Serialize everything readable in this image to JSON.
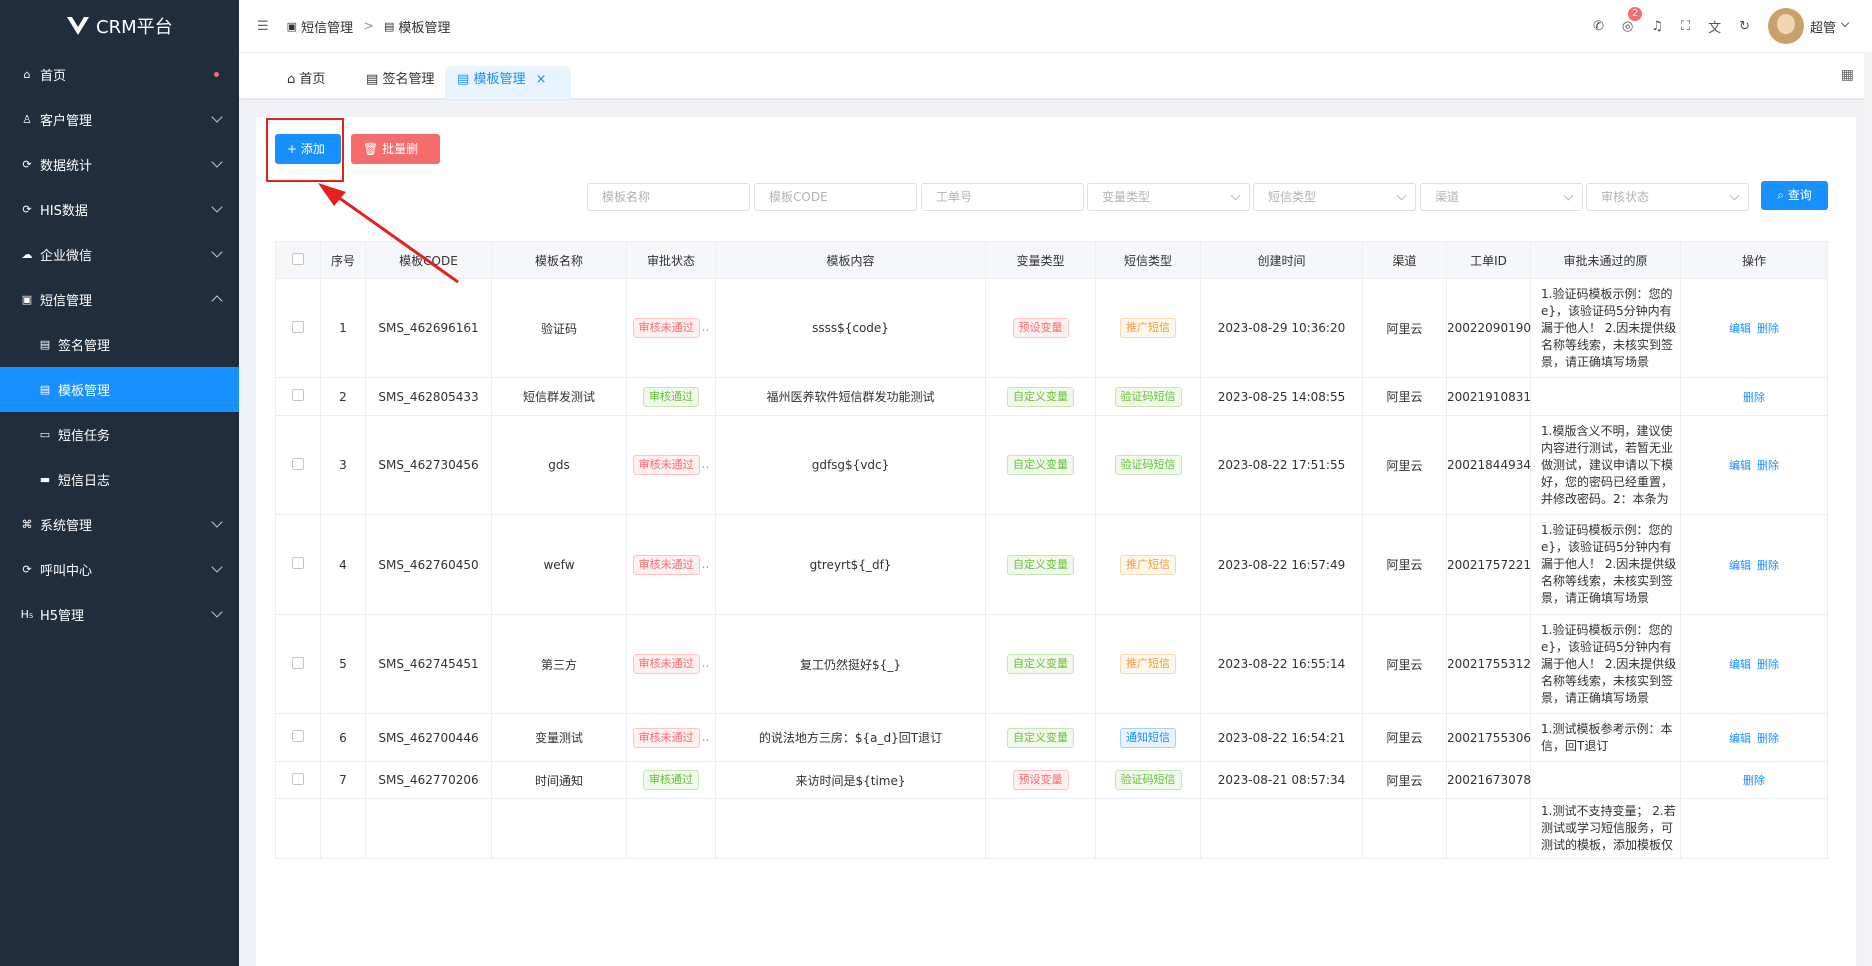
{
  "app": {
    "title": "CRM平台"
  },
  "sidebar": {
    "items": [
      {
        "label": "首页",
        "icon": "home-icon",
        "glyph": "⌂",
        "type": "dot"
      },
      {
        "label": "客户管理",
        "icon": "user-icon",
        "glyph": "♙",
        "type": "chev"
      },
      {
        "label": "数据统计",
        "icon": "stats-icon",
        "glyph": "⟳",
        "type": "chev"
      },
      {
        "label": "HIS数据",
        "icon": "his-icon",
        "glyph": "⟳",
        "type": "chev"
      },
      {
        "label": "企业微信",
        "icon": "wechat-icon",
        "glyph": "☁",
        "type": "chev"
      },
      {
        "label": "短信管理",
        "icon": "message-icon",
        "glyph": "▣",
        "type": "chevup"
      },
      {
        "label": "签名管理",
        "icon": "doc-icon",
        "glyph": "▤",
        "type": "sub"
      },
      {
        "label": "模板管理",
        "icon": "doc-icon",
        "glyph": "▤",
        "type": "sub-active"
      },
      {
        "label": "短信任务",
        "icon": "chat-icon",
        "glyph": "▭",
        "type": "sub"
      },
      {
        "label": "短信日志",
        "icon": "chat-icon",
        "glyph": "▬",
        "type": "sub"
      },
      {
        "label": "系统管理",
        "icon": "system-icon",
        "glyph": "⌘",
        "type": "chev"
      },
      {
        "label": "呼叫中心",
        "icon": "call-icon",
        "glyph": "⟳",
        "type": "chev"
      },
      {
        "label": "H5管理",
        "icon": "h5-icon",
        "glyph": "H₅",
        "type": "chev"
      }
    ]
  },
  "header": {
    "breadcrumb": [
      "短信管理",
      "模板管理"
    ],
    "badge": "2",
    "user": "超管"
  },
  "tags": {
    "home": "首页",
    "sign": "签名管理",
    "template": "模板管理",
    "close": "×"
  },
  "toolbar": {
    "add": "+ 添加",
    "batch_delete": "批量删除",
    "query": "查询"
  },
  "filters": {
    "name": "模板名称",
    "code": "模板CODE",
    "ticket": "工单号",
    "var_type": "变量类型",
    "sms_type": "短信类型",
    "channel": "渠道",
    "status": "审核状态"
  },
  "table": {
    "headers": [
      "序号",
      "模板CODE",
      "模板名称",
      "审批状态",
      "模板内容",
      "变量类型",
      "短信类型",
      "创建时间",
      "渠道",
      "工单ID",
      "审批未通过的原",
      "操作"
    ],
    "rows": [
      {
        "no": "1",
        "code": "SMS_462696161",
        "name": "验证码",
        "status": "审核未通过",
        "status_color": "red",
        "content": "ssss${code}",
        "var": "预设变量",
        "var_color": "red",
        "type": "推广短信",
        "type_color": "orange",
        "time": "2023-08-29 10:36:20",
        "channel": "阿里云",
        "ticket": "20022090190",
        "reason": [
          "1.验证码模板示例：您的",
          "e}，该验证码5分钟内有",
          "漏于他人！ 2.因未提供级",
          "名称等线索，未核实到签",
          "景，请正确填写场景"
        ],
        "edit": "编辑",
        "del": "删除",
        "h": 99
      },
      {
        "no": "2",
        "code": "SMS_462805433",
        "name": "短信群发测试",
        "status": "审核通过",
        "status_color": "green",
        "content": "福州医养软件短信群发功能测试",
        "var": "自定义变量",
        "var_color": "green",
        "type": "验证码短信",
        "type_color": "green",
        "time": "2023-08-25 14:08:55",
        "channel": "阿里云",
        "ticket": "20021910831",
        "reason": [],
        "edit": "",
        "del": "删除",
        "h": 38
      },
      {
        "no": "3",
        "code": "SMS_462730456",
        "name": "gds",
        "status": "审核未通过",
        "status_color": "red",
        "content": "gdfsg${vdc}",
        "var": "自定义变量",
        "var_color": "green",
        "type": "验证码短信",
        "type_color": "green",
        "time": "2023-08-22 17:51:55",
        "channel": "阿里云",
        "ticket": "20021844934",
        "reason": [
          "1.模版含义不明，建议使",
          "内容进行测试，若暂无业",
          "做测试，建议申请以下模",
          "好，您的密码已经重置，",
          "并修改密码。2：本条为"
        ],
        "edit": "编辑",
        "del": "删除",
        "h": 99
      },
      {
        "no": "4",
        "code": "SMS_462760450",
        "name": "wefw",
        "status": "审核未通过",
        "status_color": "red",
        "content": "gtreyrt${_df}",
        "var": "自定义变量",
        "var_color": "green",
        "type": "推广短信",
        "type_color": "orange",
        "time": "2023-08-22 16:57:49",
        "channel": "阿里云",
        "ticket": "20021757221",
        "reason": [
          "1.验证码模板示例：您的",
          "e}，该验证码5分钟内有",
          "漏于他人！ 2.因未提供级",
          "名称等线索，未核实到签",
          "景，请正确填写场景"
        ],
        "edit": "编辑",
        "del": "删除",
        "h": 100
      },
      {
        "no": "5",
        "code": "SMS_462745451",
        "name": "第三方",
        "status": "审核未通过",
        "status_color": "red",
        "content": "复工仍然挺好${_}",
        "var": "自定义变量",
        "var_color": "green",
        "type": "推广短信",
        "type_color": "orange",
        "time": "2023-08-22 16:55:14",
        "channel": "阿里云",
        "ticket": "20021755312",
        "reason": [
          "1.验证码模板示例：您的",
          "e}，该验证码5分钟内有",
          "漏于他人！ 2.因未提供级",
          "名称等线索，未核实到签",
          "景，请正确填写场景"
        ],
        "edit": "编辑",
        "del": "删除",
        "h": 99
      },
      {
        "no": "6",
        "code": "SMS_462700446",
        "name": "变量测试",
        "status": "审核未通过",
        "status_color": "red",
        "content": "的说法地方三房：${a_d}回T退订",
        "var": "自定义变量",
        "var_color": "green",
        "type": "通知短信",
        "type_color": "blue",
        "time": "2023-08-22 16:54:21",
        "channel": "阿里云",
        "ticket": "20021755306",
        "reason": [
          "1.测试模板参考示例：本",
          "信，回T退订"
        ],
        "edit": "编辑",
        "del": "删除",
        "h": 48
      },
      {
        "no": "7",
        "code": "SMS_462770206",
        "name": "时间通知",
        "status": "审核通过",
        "status_color": "green",
        "content": "来访时间是${time}",
        "var": "预设变量",
        "var_color": "red",
        "type": "验证码短信",
        "type_color": "green",
        "time": "2023-08-21 08:57:34",
        "channel": "阿里云",
        "ticket": "20021673078",
        "reason": [],
        "edit": "",
        "del": "删除",
        "h": 37
      },
      {
        "no": "",
        "code": "",
        "name": "",
        "status": "",
        "status_color": "",
        "content": "",
        "var": "",
        "var_color": "",
        "type": "",
        "type_color": "",
        "time": "",
        "channel": "",
        "ticket": "",
        "reason": [
          "1.测试不支持变量； 2.若",
          "测试或学习短信服务，可",
          "测试的模板，添加模板仅"
        ],
        "edit": "",
        "del": "",
        "h": 60
      }
    ]
  }
}
